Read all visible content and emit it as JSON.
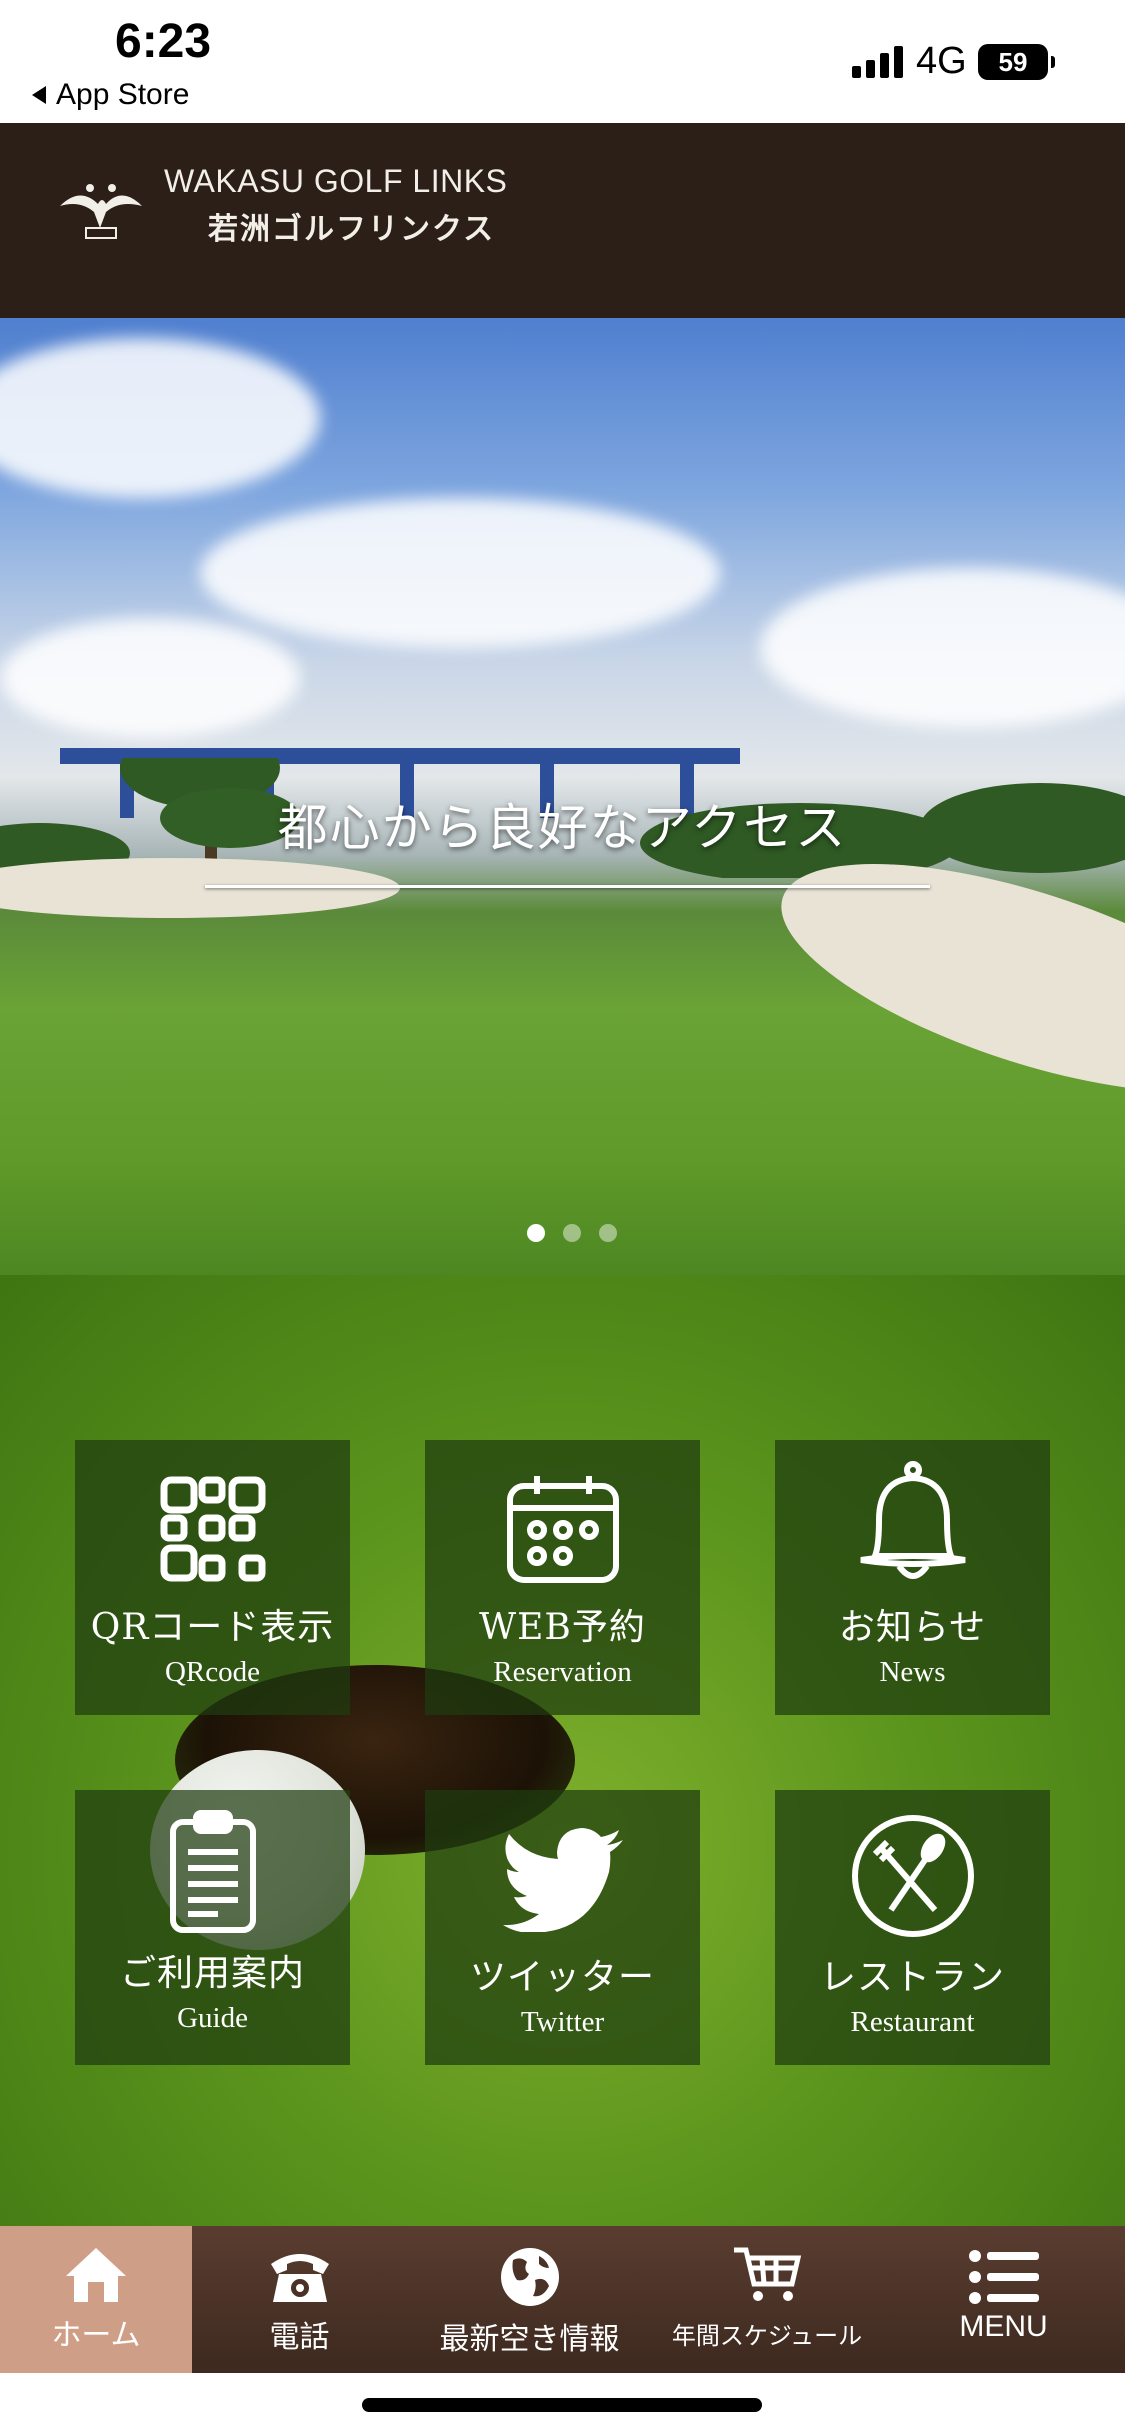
{
  "status_bar": {
    "time": "6:23",
    "back_label": "App Store",
    "network": "4G",
    "battery": "59"
  },
  "header": {
    "logo_en": "WAKASU GOLF LINKS",
    "logo_jp": "若洲ゴルフリンクス"
  },
  "hero": {
    "caption": "都心から良好なアクセス",
    "slide_count": 3,
    "active_slide": 1
  },
  "menu": {
    "items": [
      {
        "jp": "QRコード表示",
        "en": "QRcode",
        "icon": "qr-code-icon"
      },
      {
        "jp": "WEB予約",
        "en": "Reservation",
        "icon": "calendar-icon"
      },
      {
        "jp": "お知らせ",
        "en": "News",
        "icon": "bell-icon"
      },
      {
        "jp": "ご利用案内",
        "en": "Guide",
        "icon": "clipboard-icon"
      },
      {
        "jp": "ツイッター",
        "en": "Twitter",
        "icon": "twitter-bird-icon"
      },
      {
        "jp": "レストラン",
        "en": "Restaurant",
        "icon": "fork-spoon-icon"
      }
    ]
  },
  "tabbar": {
    "items": [
      {
        "label": "ホーム",
        "icon": "home-icon",
        "active": true
      },
      {
        "label": "電話",
        "icon": "phone-icon"
      },
      {
        "label": "最新空き情報",
        "icon": "globe-icon"
      },
      {
        "label": "年間スケジュール",
        "icon": "cart-icon"
      },
      {
        "label": "MENU",
        "icon": "list-icon"
      }
    ]
  },
  "colors": {
    "header_bg": "#2b1f18",
    "tabbar_bg": "#4a3226",
    "tab_active_bg": "#cf9e86",
    "tile_bg": "#1e3c0f"
  }
}
